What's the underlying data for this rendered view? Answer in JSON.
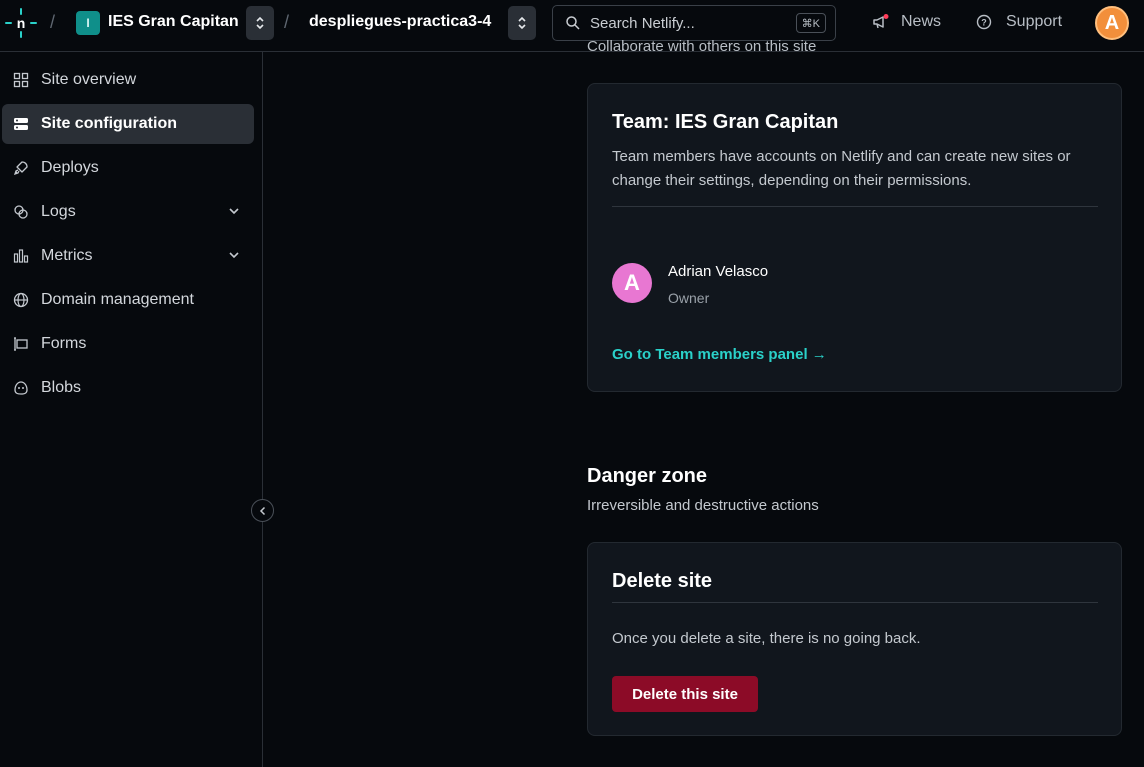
{
  "header": {
    "team_initial": "I",
    "team_name": "IES Gran Capitan",
    "site_name": "despliegues-practica3-4",
    "search": {
      "placeholder": "Search Netlify...",
      "shortcut": "⌘K"
    },
    "news_label": "News",
    "support_label": "Support",
    "user_initial": "A"
  },
  "sidebar": {
    "items": [
      {
        "label": "Site overview",
        "icon": "grid-icon"
      },
      {
        "label": "Site configuration",
        "icon": "server-icon",
        "active": true
      },
      {
        "label": "Deploys",
        "icon": "rocket-icon"
      },
      {
        "label": "Logs",
        "icon": "logs-icon",
        "expandable": true
      },
      {
        "label": "Metrics",
        "icon": "bar-chart-icon",
        "expandable": true
      },
      {
        "label": "Domain management",
        "icon": "globe-icon"
      },
      {
        "label": "Forms",
        "icon": "form-icon"
      },
      {
        "label": "Blobs",
        "icon": "blob-icon"
      }
    ]
  },
  "main": {
    "cut_off_text": "Collaborate with others on this site",
    "team_card": {
      "title": "Team: IES Gran Capitan",
      "description": "Team members have accounts on Netlify and can create new sites or change their settings, depending on their permissions.",
      "member": {
        "initial": "A",
        "name": "Adrian Velasco",
        "role": "Owner"
      },
      "link": "Go to Team members panel →"
    },
    "danger_zone": {
      "title": "Danger zone",
      "description": "Irreversible and destructive actions"
    },
    "delete_card": {
      "title": "Delete site",
      "description": "Once you delete a site, there is no going back.",
      "button": "Delete this site"
    }
  },
  "colors": {
    "background": "#06090d",
    "card": "#11161d",
    "accent_link": "#2ad1c9",
    "danger": "#8c0b27",
    "team_badge": "#0f8f8a",
    "user_avatar": "#f28f3b",
    "member_avatar": "#e877d2"
  }
}
